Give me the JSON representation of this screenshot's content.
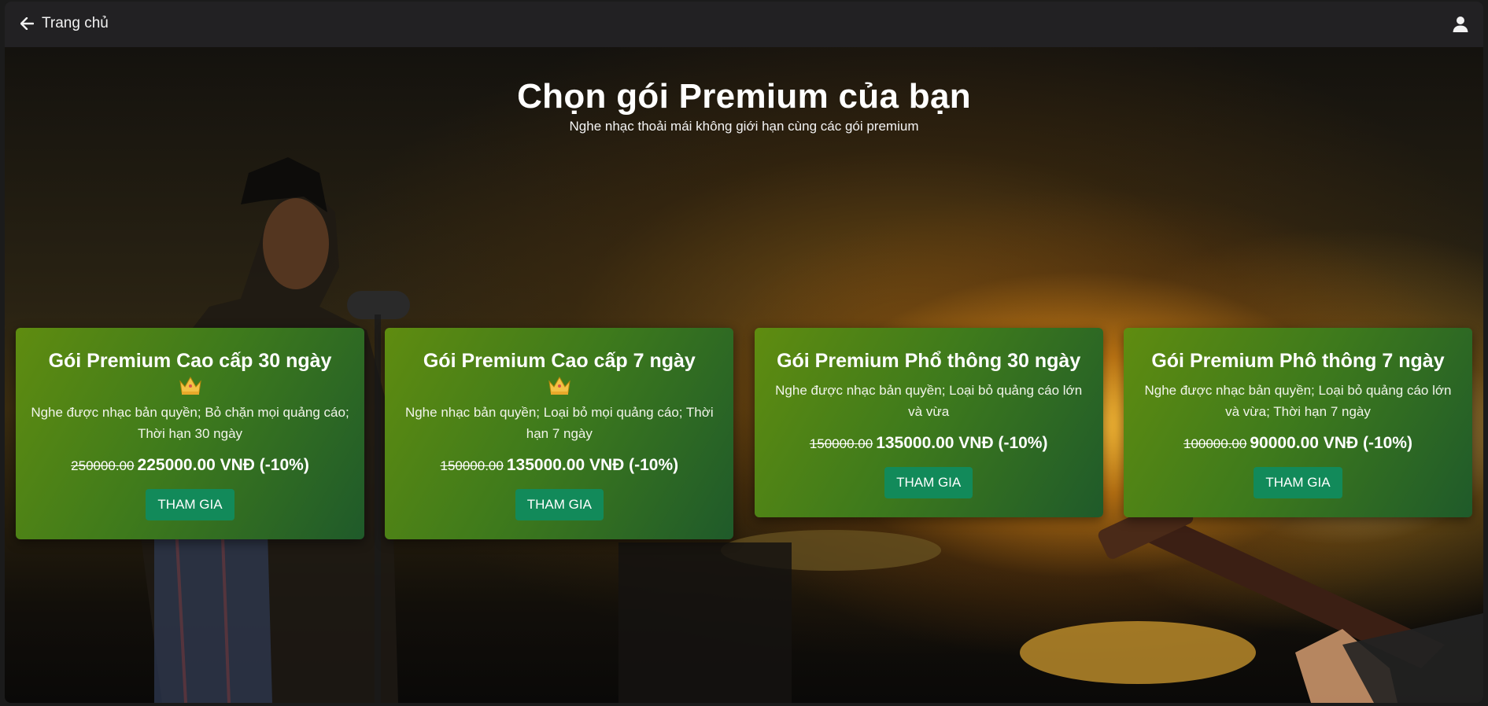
{
  "topbar": {
    "back_label": "Trang chủ",
    "back_icon": "arrow-left-icon",
    "user_icon": "user-icon"
  },
  "hero": {
    "title": "Chọn gói Premium của bạn",
    "subtitle": "Nghe nhạc thoải mái không giới hạn cùng các gói premium"
  },
  "plans": [
    {
      "name": "Gói Premium Cao cấp 30 ngày",
      "crown": true,
      "description": "Nghe được nhạc bản quyền; Bỏ chặn mọi quảng cáo; Thời hạn 30 ngày",
      "old_price": "250000.00",
      "price": "225000.00 VNĐ (-10%)",
      "button": "THAM GIA"
    },
    {
      "name": "Gói Premium Cao cấp 7 ngày",
      "crown": true,
      "description": "Nghe nhạc bản quyền; Loại bỏ mọi quảng cáo; Thời hạn 7 ngày",
      "old_price": "150000.00",
      "price": "135000.00 VNĐ (-10%)",
      "button": "THAM GIA"
    },
    {
      "name": "Gói Premium Phổ thông 30 ngày",
      "crown": false,
      "description": "Nghe được nhạc bản quyền; Loại bỏ quảng cáo lớn và vừa",
      "old_price": "150000.00",
      "price": "135000.00 VNĐ (-10%)",
      "button": "THAM GIA"
    },
    {
      "name": "Gói Premium Phô thông 7 ngày",
      "crown": false,
      "description": "Nghe được nhạc bản quyền; Loại bỏ quảng cáo lớn và vừa; Thời hạn 7 ngày",
      "old_price": "100000.00",
      "price": "90000.00 VNĐ (-10%)",
      "button": "THAM GIA"
    }
  ],
  "colors": {
    "topbar": "#222123",
    "card_start": "#5f8c10",
    "card_end": "#1f5a2a",
    "button": "#128a5a"
  }
}
